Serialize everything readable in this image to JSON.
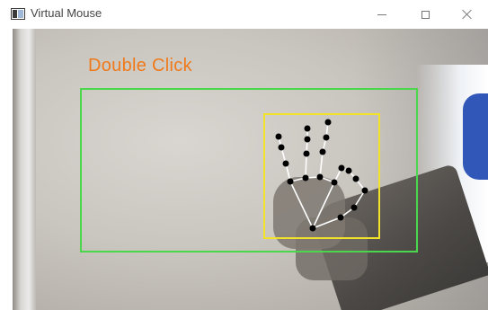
{
  "window": {
    "title": "Virtual Mouse",
    "controls": {
      "minimize": "minimize",
      "maximize": "maximize",
      "close": "close"
    }
  },
  "overlay": {
    "gesture_label": "Double Click",
    "frame_box_color": "#4cd64c",
    "hand_box_color": "#f2e22a",
    "label_color": "#f07a1a",
    "landmark_color": "#000000",
    "connection_color": "#ffffff"
  },
  "icons": {
    "app_icon": "app-window-icon",
    "minimize_icon": "minimize-icon",
    "maximize_icon": "maximize-icon",
    "close_icon": "close-icon"
  }
}
